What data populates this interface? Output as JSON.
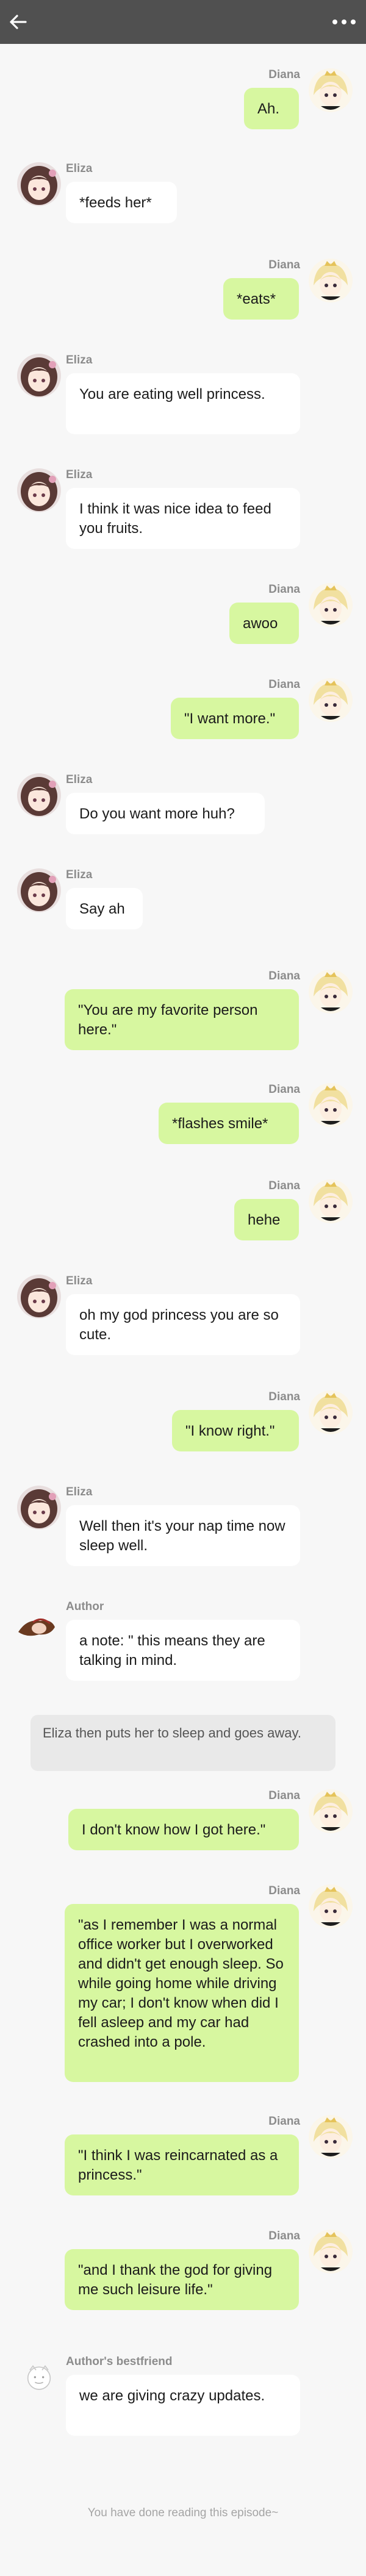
{
  "colors": {
    "header_bg": "#505050",
    "bubble_green": "#d7f7a0",
    "bubble_white": "#ffffff",
    "page_bg": "#f7f7f7"
  },
  "header": {
    "back_icon": "back-arrow-icon",
    "menu_icon": "more-dots-icon"
  },
  "messages": [
    {
      "speaker": "Diana",
      "side": "right",
      "text": "Ah."
    },
    {
      "speaker": "Eliza",
      "side": "left",
      "text": "*feeds her*"
    },
    {
      "speaker": "Diana",
      "side": "right",
      "text": "*eats*"
    },
    {
      "speaker": "Eliza",
      "side": "left",
      "text": "You are eating well princess."
    },
    {
      "speaker": "Eliza",
      "side": "left",
      "text": "I think it was nice idea to feed you fruits."
    },
    {
      "speaker": "Diana",
      "side": "right",
      "text": "awoo"
    },
    {
      "speaker": "Diana",
      "side": "right",
      "text": "\"I want more.\""
    },
    {
      "speaker": "Eliza",
      "side": "left",
      "text": "Do you want more huh?"
    },
    {
      "speaker": "Eliza",
      "side": "left",
      "text": "Say ah"
    },
    {
      "speaker": "Diana",
      "side": "right",
      "text": "\"You are my favorite person here.\""
    },
    {
      "speaker": "Diana",
      "side": "right",
      "text": "*flashes smile*"
    },
    {
      "speaker": "Diana",
      "side": "right",
      "text": "hehe"
    },
    {
      "speaker": "Eliza",
      "side": "left",
      "text": "oh my god princess you are so cute."
    },
    {
      "speaker": "Diana",
      "side": "right",
      "text": "\"I know right.\""
    },
    {
      "speaker": "Eliza",
      "side": "left",
      "text": "Well then it's your nap time now sleep well."
    },
    {
      "speaker": "Author",
      "side": "left",
      "text": "a note: \" this means they are talking in mind."
    },
    {
      "speaker": "Diana",
      "side": "right",
      "text": "I don't know how I got here.\""
    },
    {
      "speaker": "Diana",
      "side": "right",
      "text": "\"as I remember I was a normal office worker but I overworked and didn't get enough sleep. So while going home while driving my car; I don't know when did I fell asleep and my car had crashed into a pole."
    },
    {
      "speaker": "Diana",
      "side": "right",
      "text": "\"I think I was reincarnated as a princess.\""
    },
    {
      "speaker": "Diana",
      "side": "right",
      "text": "\"and I thank the god for giving me such leisure life.\""
    },
    {
      "speaker": "Author's bestfriend",
      "side": "left",
      "text": "we are giving crazy updates."
    }
  ],
  "narration": "Eliza then puts her to sleep and goes away.",
  "footer": "You have done reading this episode~"
}
